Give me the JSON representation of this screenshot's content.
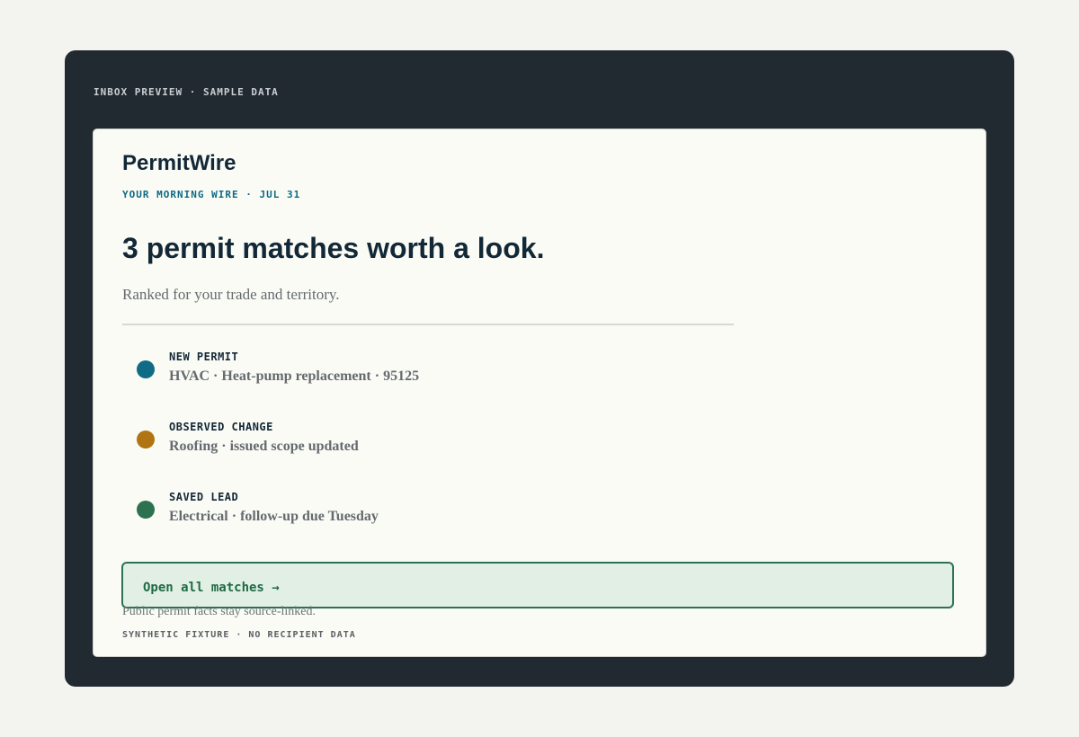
{
  "frame": {
    "label": "INBOX PREVIEW · SAMPLE DATA"
  },
  "email": {
    "brand": "PermitWire",
    "kicker": "YOUR MORNING WIRE · JUL 31",
    "headline": "3 permit matches worth a look.",
    "subhead": "Ranked for your trade and territory.",
    "matches": [
      {
        "label": "NEW PERMIT",
        "detail": "HVAC · Heat-pump replacement · 95125",
        "color": "#0f6b86"
      },
      {
        "label": "OBSERVED CHANGE",
        "detail": "Roofing · issued scope updated",
        "color": "#b07413"
      },
      {
        "label": "SAVED LEAD",
        "detail": "Electrical · follow-up due Tuesday",
        "color": "#2c7250"
      }
    ],
    "cta_label": "Open all matches →",
    "footnote": "Public permit facts stay source-linked.",
    "fixture_note": "SYNTHETIC FIXTURE · NO RECIPIENT DATA"
  }
}
